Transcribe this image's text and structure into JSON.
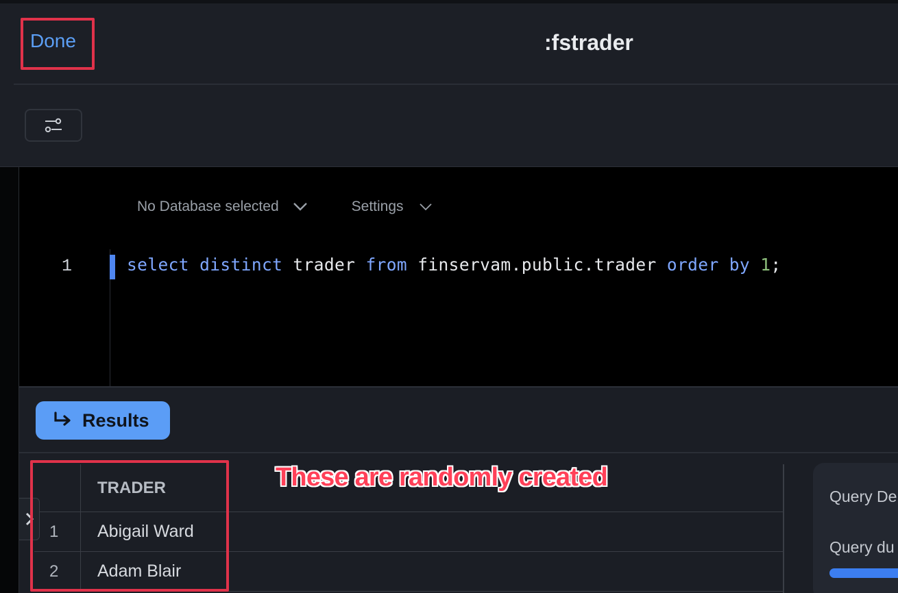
{
  "header": {
    "done_label": "Done",
    "title": ":fstrader"
  },
  "editor": {
    "database_select": "No Database selected",
    "settings_select": "Settings",
    "line_number": "1",
    "code_tokens": [
      {
        "text": "select",
        "type": "kw"
      },
      {
        "text": " ",
        "type": "plain"
      },
      {
        "text": "distinct",
        "type": "kw"
      },
      {
        "text": " trader ",
        "type": "plain"
      },
      {
        "text": "from",
        "type": "kw"
      },
      {
        "text": " finservam.public.trader ",
        "type": "plain"
      },
      {
        "text": "order",
        "type": "kw"
      },
      {
        "text": " ",
        "type": "plain"
      },
      {
        "text": "by",
        "type": "kw"
      },
      {
        "text": " ",
        "type": "plain"
      },
      {
        "text": "1",
        "type": "num"
      },
      {
        "text": ";",
        "type": "plain"
      }
    ]
  },
  "results": {
    "button_label": "Results",
    "column_header": "TRADER",
    "rows": [
      {
        "num": "1",
        "trader": "Abigail Ward"
      },
      {
        "num": "2",
        "trader": "Adam Blair"
      }
    ]
  },
  "annotation": {
    "text": "These are randomly created",
    "color": "#ff4058"
  },
  "query_panel": {
    "title": "Query De",
    "label": "Query du"
  },
  "colors": {
    "accent": "#5c9ff5",
    "highlight_box": "#e0324a",
    "results_button": "#5b9df6"
  },
  "icons": {
    "filter": "sliders-icon",
    "results": "arrow-return-icon",
    "chevron": "chevron-down-icon",
    "side_toggle": "chevron-right-icon"
  }
}
